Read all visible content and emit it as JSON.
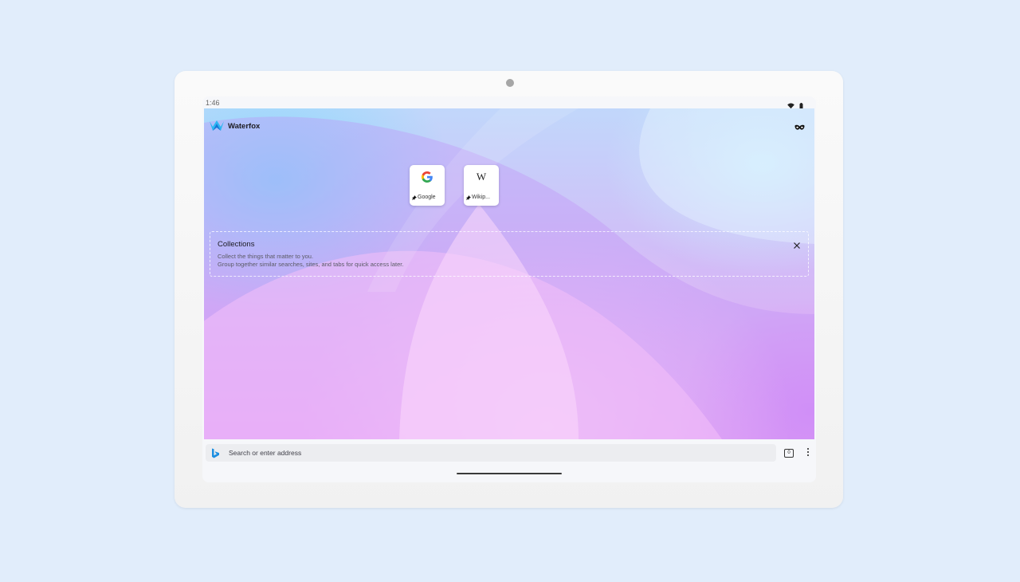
{
  "status_bar": {
    "time": "1:46",
    "wifi_icon": "wifi-icon",
    "battery_icon": "battery-icon"
  },
  "app": {
    "name": "Waterfox",
    "logo_icon": "waterfox-logo-icon",
    "private_mode_icon": "private-mask-icon"
  },
  "top_sites": [
    {
      "label": "Google",
      "logo": "G",
      "pin_icon": "pin-icon"
    },
    {
      "label": "Wikip...",
      "logo": "W",
      "pin_icon": "pin-icon"
    }
  ],
  "collections": {
    "title": "Collections",
    "description_line1": "Collect the things that matter to you.",
    "description_line2": "Group together similar searches, sites, and tabs for quick access later.",
    "close_icon": "close-icon"
  },
  "toolbar": {
    "search_placeholder": "Search or enter address",
    "search_engine_icon": "bing-icon",
    "tab_count": "0",
    "menu_icon": "more-vertical-icon"
  },
  "colors": {
    "page_background": "#e1edfb",
    "toolbar_background": "#f6f7fa",
    "urlbar_background": "#ecedf0",
    "text_primary": "#1c1b22"
  }
}
